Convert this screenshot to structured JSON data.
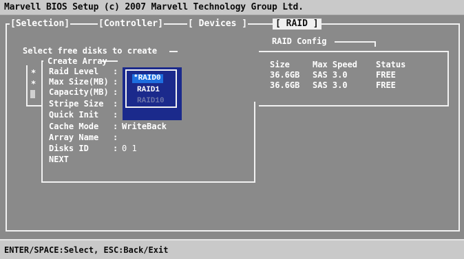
{
  "title": "Marvell BIOS Setup (c) 2007 Marvell Technology Group Ltd.",
  "tabs": [
    {
      "label": "[Selection]"
    },
    {
      "label": "[Controller]"
    },
    {
      "label": "[ Devices ]"
    },
    {
      "label": "[ RAID ]"
    }
  ],
  "raid_config_title": "RAID Config",
  "select_free_disks": "Select free disks to create",
  "disk_markers": [
    "*",
    "*"
  ],
  "disk_table": {
    "headers": [
      "Size",
      "Max Speed",
      "Status"
    ],
    "rows": [
      [
        "36.6GB",
        "SAS 3.0",
        "FREE"
      ],
      [
        "36.6GB",
        "SAS 3.0",
        "FREE"
      ]
    ]
  },
  "create_array": {
    "title": "Create Array",
    "fields": [
      {
        "label": "Raid Level",
        "colon": ":",
        "value": ""
      },
      {
        "label": "Max Size(MB)",
        "colon": ":",
        "value": ""
      },
      {
        "label": "Capacity(MB)",
        "colon": ":",
        "value": ""
      },
      {
        "label": "Stripe Size",
        "colon": ":",
        "value": ""
      },
      {
        "label": "Quick Init",
        "colon": ":",
        "value": ""
      },
      {
        "label": "Cache Mode",
        "colon": ":",
        "value": "WriteBack"
      },
      {
        "label": "Array Name",
        "colon": ":",
        "value": ""
      },
      {
        "label": "Disks ID",
        "colon": ":",
        "value": "0 1"
      }
    ],
    "next_label": "NEXT"
  },
  "raid_level_options": [
    {
      "label": "*RAID0",
      "state": "selected"
    },
    {
      "label": "RAID1",
      "state": "normal"
    },
    {
      "label": "RAID10",
      "state": "disabled"
    }
  ],
  "status_help": "ENTER/SPACE:Select, ESC:Back/Exit",
  "colors": {
    "background": "#8a8a8a",
    "bars": "#c9c9c9",
    "popup": "#1b2a8c",
    "selection": "#1e6fe0",
    "active_tab": "#f0f0f0"
  }
}
